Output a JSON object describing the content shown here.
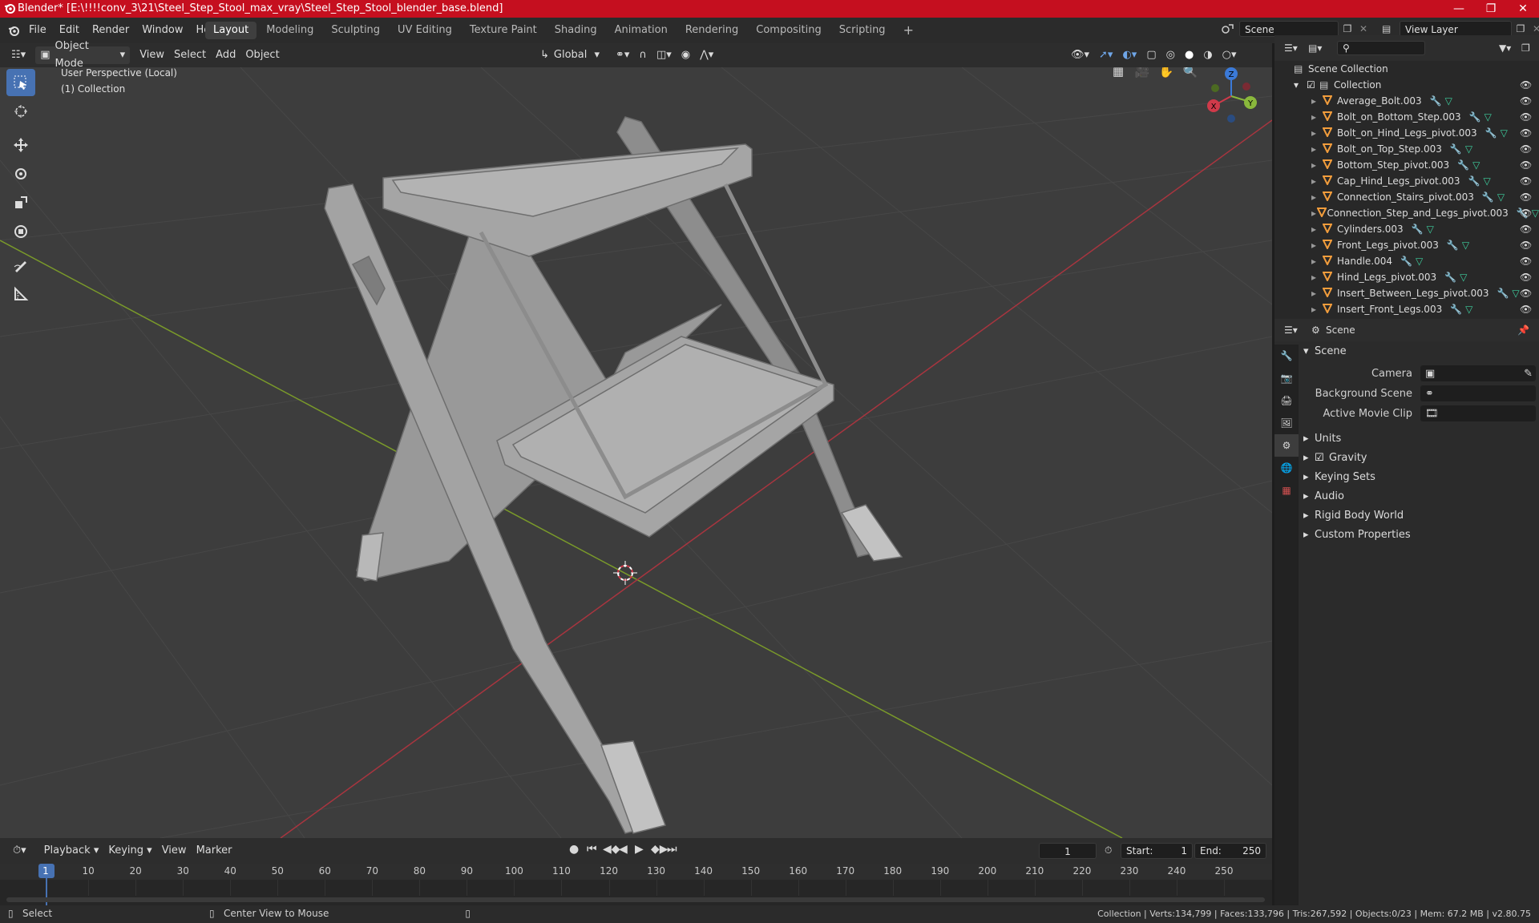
{
  "title_bar": {
    "title": "Blender* [E:\\!!!!conv_3\\21\\Steel_Step_Stool_max_vray\\Steel_Step_Stool_blender_base.blend]"
  },
  "menu": [
    "File",
    "Edit",
    "Render",
    "Window",
    "Help"
  ],
  "workspaces": [
    "Layout",
    "Modeling",
    "Sculpting",
    "UV Editing",
    "Texture Paint",
    "Shading",
    "Animation",
    "Rendering",
    "Compositing",
    "Scripting"
  ],
  "active_workspace": "Layout",
  "scene_field": "Scene",
  "view_layer_field": "View Layer",
  "viewport_header": {
    "mode": "Object Mode",
    "menus": [
      "View",
      "Select",
      "Add",
      "Object"
    ],
    "transform_orientation": "Global"
  },
  "viewport": {
    "perspective_label": "User Perspective (Local)",
    "collection_label": "(1) Collection",
    "gizmo": {
      "x": "X",
      "y": "Y",
      "z": "Z"
    }
  },
  "outliner": {
    "root": "Scene Collection",
    "collection": "Collection",
    "objects": [
      "Average_Bolt.003",
      "Bolt_on_Bottom_Step.003",
      "Bolt_on_Hind_Legs_pivot.003",
      "Bolt_on_Top_Step.003",
      "Bottom_Step_pivot.003",
      "Cap_Hind_Legs_pivot.003",
      "Connection_Stairs_pivot.003",
      "Connection_Step_and_Legs_pivot.003",
      "Cylinders.003",
      "Front_Legs_pivot.003",
      "Handle.004",
      "Hind_Legs_pivot.003",
      "Insert_Between_Legs_pivot.003",
      "Insert_Front_Legs.003"
    ]
  },
  "properties": {
    "header": "Scene",
    "section": "Scene",
    "fields": [
      {
        "label": "Camera"
      },
      {
        "label": "Background Scene"
      },
      {
        "label": "Active Movie Clip"
      }
    ],
    "panels": [
      "Units",
      "Gravity",
      "Keying Sets",
      "Audio",
      "Rigid Body World",
      "Custom Properties"
    ],
    "gravity_checked": true
  },
  "timeline": {
    "menus": [
      "Playback",
      "Keying",
      "View",
      "Marker"
    ],
    "current_frame": "1",
    "start_label": "Start:",
    "start": "1",
    "end_label": "End:",
    "end": "250",
    "ticks": [
      "1",
      "10",
      "20",
      "30",
      "40",
      "50",
      "60",
      "70",
      "80",
      "90",
      "100",
      "110",
      "120",
      "130",
      "140",
      "150",
      "160",
      "170",
      "180",
      "190",
      "200",
      "210",
      "220",
      "230",
      "240",
      "250"
    ]
  },
  "status_bar": {
    "select": "Select",
    "center_view": "Center View to Mouse",
    "stats": "Collection | Verts:134,799 | Faces:133,796 | Tris:267,592 | Objects:0/23 | Mem: 67.2 MB | v2.80.75"
  },
  "colors": {
    "title_bar": "#c50f1f",
    "accent": "#4772b3",
    "object_icon": "#f29d3c",
    "modifier_icon": "#6fa6e8",
    "mesh_icon": "#3ed1a0",
    "x_axis": "#d03a4a",
    "y_axis": "#8ab83c",
    "z_axis": "#3b7ad8"
  }
}
